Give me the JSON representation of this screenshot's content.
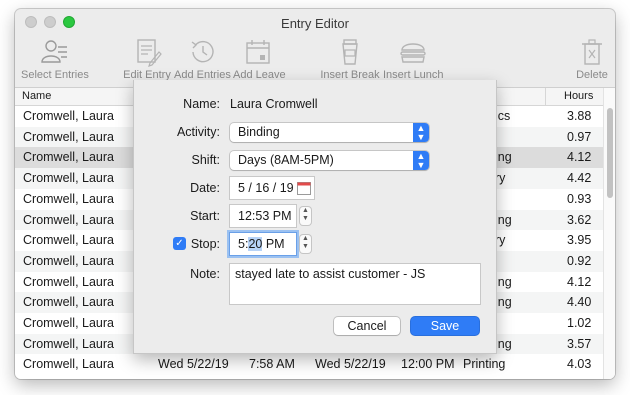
{
  "window": {
    "title": "Entry Editor"
  },
  "toolbar": {
    "items": [
      {
        "label": "Select Entries",
        "icon": "select-entries-icon"
      },
      {
        "label": "Edit Entry",
        "icon": "edit-entry-icon"
      },
      {
        "label": "Add Entries",
        "icon": "add-entries-icon"
      },
      {
        "label": "Add Leave",
        "icon": "add-leave-icon"
      },
      {
        "label": "Insert Break",
        "icon": "coffee-cup-icon"
      },
      {
        "label": "Insert Lunch",
        "icon": "burger-icon"
      },
      {
        "label": "Delete",
        "icon": "trash-icon"
      }
    ]
  },
  "table": {
    "headers": {
      "name": "Name",
      "hours": "Hours"
    },
    "rows": [
      {
        "name": "Cromwell, Laura",
        "activity": "ics",
        "hours": "3.88"
      },
      {
        "name": "Cromwell, Laura",
        "activity": "",
        "hours": "0.97"
      },
      {
        "name": "Cromwell, Laura",
        "activity": "ing",
        "hours": "4.12"
      },
      {
        "name": "Cromwell, Laura",
        "activity": "ry",
        "hours": "4.42"
      },
      {
        "name": "Cromwell, Laura",
        "activity": "",
        "hours": "0.93"
      },
      {
        "name": "Cromwell, Laura",
        "activity": "ing",
        "hours": "3.62"
      },
      {
        "name": "Cromwell, Laura",
        "activity": "ry",
        "hours": "3.95"
      },
      {
        "name": "Cromwell, Laura",
        "activity": "",
        "hours": "0.92"
      },
      {
        "name": "Cromwell, Laura",
        "activity": "ing",
        "hours": "4.12"
      },
      {
        "name": "Cromwell, Laura",
        "activity": "ing",
        "hours": "4.40"
      },
      {
        "name": "Cromwell, Laura",
        "activity": "",
        "hours": "1.02"
      },
      {
        "name": "Cromwell, Laura",
        "activity": "ing",
        "hours": "3.57"
      },
      {
        "name": "Cromwell, Laura",
        "start_date": "Wed 5/22/19",
        "start_time": "7:58 AM",
        "end_date": "Wed 5/22/19",
        "end_time": "12:00 PM",
        "activity": "Printing",
        "hours": "4.03"
      }
    ]
  },
  "form": {
    "name_label": "Name:",
    "name_value": "Laura Cromwell",
    "activity_label": "Activity:",
    "activity_value": "Binding",
    "shift_label": "Shift:",
    "shift_value": "Days (8AM-5PM)",
    "date_label": "Date:",
    "date_value": "5 / 16 / 19",
    "start_label": "Start:",
    "start_value": "12:53 PM",
    "stop_label": "Stop:",
    "stop_checked": true,
    "stop_hour": "5",
    "stop_minute": "20",
    "stop_ampm": "PM",
    "note_label": "Note:",
    "note_value": "stayed late to assist customer - JS",
    "cancel_label": "Cancel",
    "save_label": "Save"
  },
  "colors": {
    "accent": "#2f7cf6",
    "selected_row": "#dcdcdc",
    "close_button": "#2bc840"
  }
}
